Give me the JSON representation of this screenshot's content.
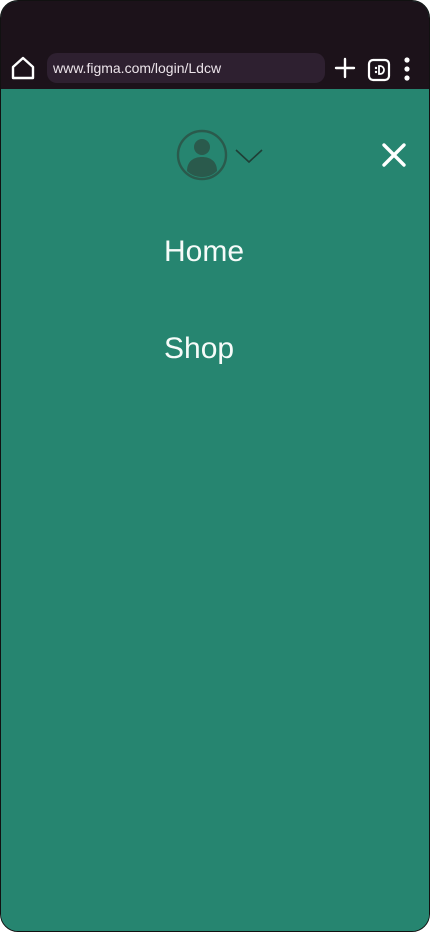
{
  "browser": {
    "url": "www.figma.com/login/Ldcw",
    "icons": {
      "home": "home-icon",
      "new_tab": "plus-icon",
      "tabs": "tab-switcher-icon",
      "more": "more-vertical-icon"
    }
  },
  "menu": {
    "avatar_icon": "user-avatar-icon",
    "dropdown_icon": "chevron-down-icon",
    "close_icon": "close-icon",
    "items": [
      {
        "label": "Home"
      },
      {
        "label": "Shop"
      }
    ]
  },
  "colors": {
    "browser_bar": "#1c121a",
    "url_field": "#2e2030",
    "menu_background": "#268570",
    "avatar": "#2a5a4c",
    "text": "#f6fbf9"
  }
}
